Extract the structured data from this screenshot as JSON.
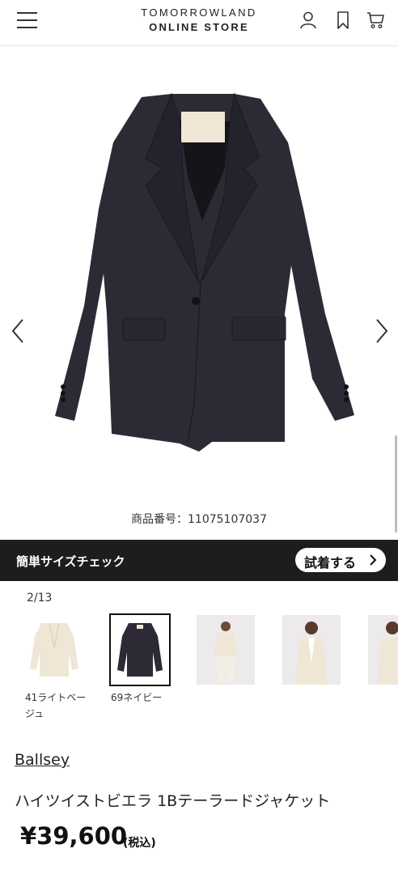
{
  "header": {
    "logo_line1": "TOMORROWLAND",
    "logo_line2": "ONLINE STORE",
    "icons": [
      "menu-icon",
      "user-icon",
      "bookmark-icon",
      "cart-icon"
    ]
  },
  "product": {
    "code_text": "商品番号：11075107037",
    "brand": "Ballsey",
    "name": "ハイツイストビエラ 1Bテーラードジャケット",
    "price": "¥39,600",
    "tax_note": "(税込)"
  },
  "size_bar": {
    "title": "簡単サイズチェック",
    "try_label": "試着する"
  },
  "gallery": {
    "pager": "2/13",
    "colors": [
      {
        "label_line1": "41ライトベー",
        "label_line2": "ジュ"
      },
      {
        "label_line1": "69ネイビー",
        "label_line2": ""
      }
    ]
  },
  "colors": {
    "jacket": "#2d2a36",
    "beige": "#efe6d6",
    "bar": "#1d1d1d"
  }
}
